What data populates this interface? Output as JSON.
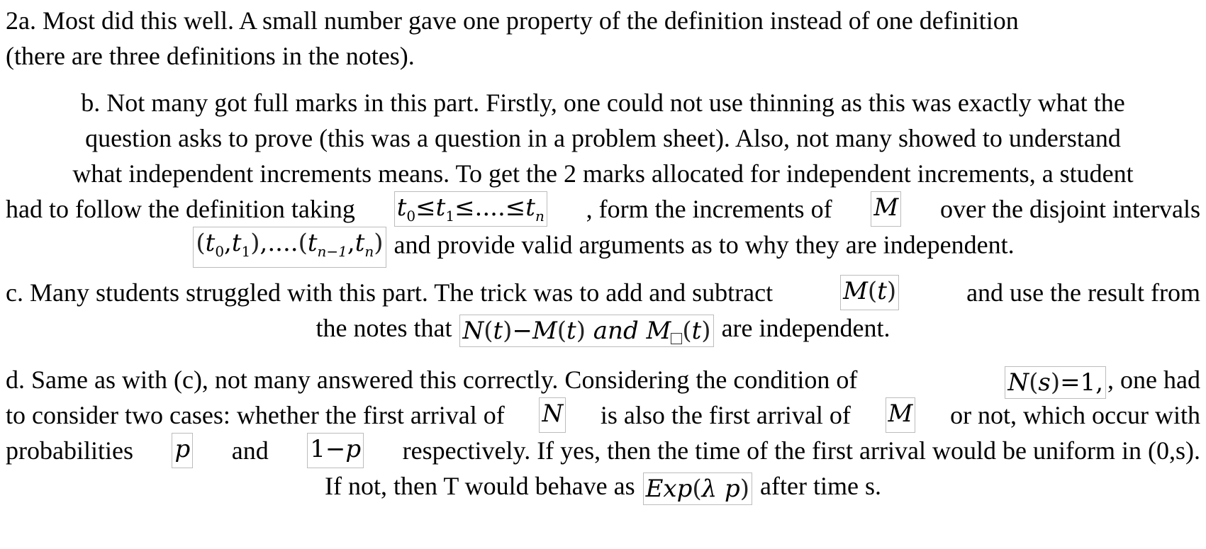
{
  "p2a": {
    "line1": "2a. Most did this well. A small number gave one property of the definition instead of one definition",
    "line2": "(there are three definitions in the notes)."
  },
  "pb": {
    "line1": "b. Not many got full marks in this part. Firstly, one could not use thinning as this was exactly what the",
    "line2": "question asks to prove (this was a question in a problem sheet). Also, not many showed to understand",
    "line3": "what independent increments means. To get the 2 marks allocated for independent increments, a student",
    "line4_pre": "had to follow the definition taking",
    "line4_mid": ", form the increments of",
    "line4_post": "over the disjoint intervals",
    "line5_post": "and provide valid arguments as to why they are independent."
  },
  "pc": {
    "line1_pre": "c. Many students struggled with this part. The trick was to add and subtract",
    "line1_post": "and use the result from",
    "line2_pre": "the notes that",
    "line2_post": "are independent."
  },
  "pd": {
    "line1_pre": "d. Same as with (c), not many answered this correctly. Considering the condition of",
    "line1_post": ", one had",
    "line2_pre": "to consider two cases: whether the first arrival of",
    "line2_mid": "is also the first arrival of",
    "line2_post": "or not, which occur with",
    "line3_pre": "probabilities",
    "line3_mid": "and",
    "line3_post": "respectively. If yes, then the time of the first arrival would be uniform in (0,s).",
    "line4_pre": "If not, then T would behave as",
    "line4_post": "after time s."
  },
  "math": {
    "t": "t",
    "n": "n",
    "n_minus_1": "n−1",
    "zero": "0",
    "one": "1",
    "leq_dots": "≤....≤",
    "leq": "≤",
    "M": "M",
    "N": "N",
    "s": "s",
    "eq_one": "=1",
    "comma": ",",
    "dots_comma": ",....",
    "minus": "−",
    "and_word": "and",
    "p": "p",
    "one_minus": "1−",
    "Exp": "Exp",
    "lambda": "λ"
  }
}
